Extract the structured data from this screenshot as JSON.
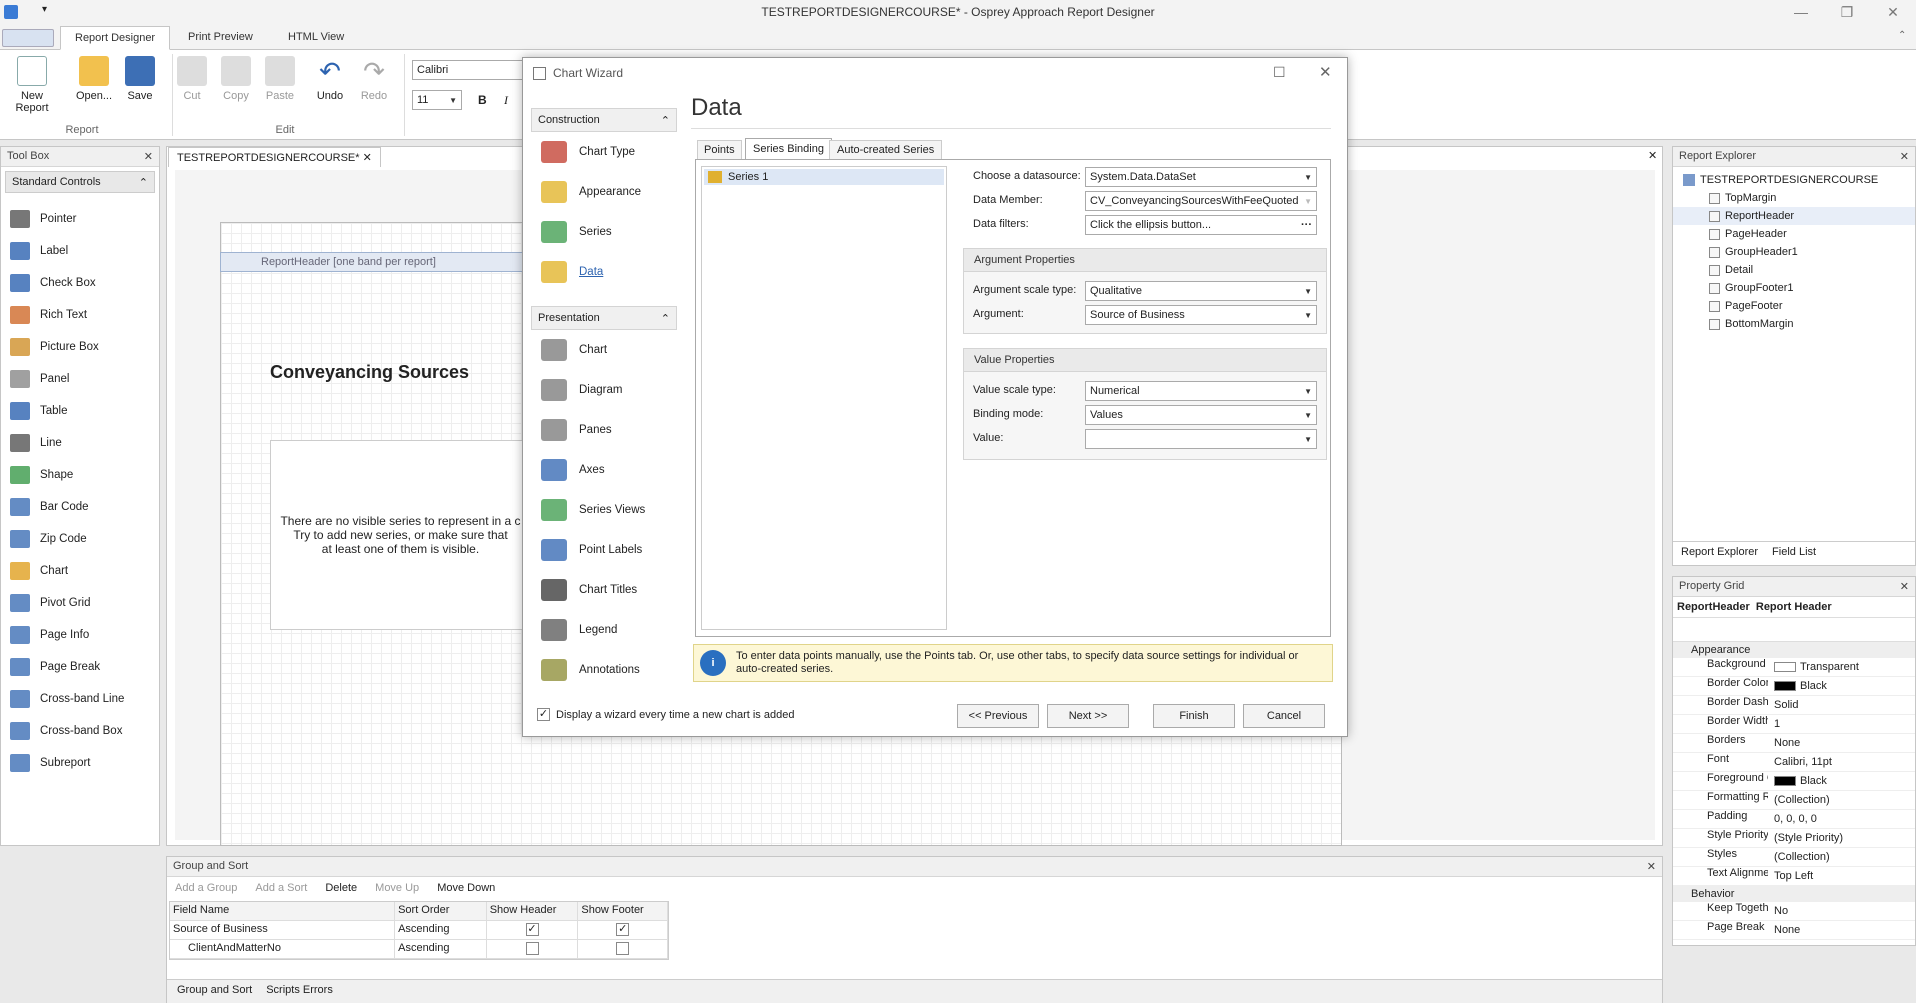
{
  "window": {
    "title": "TESTREPORTDESIGNERCOURSE* - Osprey Approach Report Designer"
  },
  "ribbon_tabs": [
    "Report Designer",
    "Print Preview",
    "HTML View"
  ],
  "ribbon": {
    "report_buttons": [
      "New Report",
      "Open...",
      "Save"
    ],
    "edit_buttons": [
      "Cut",
      "Copy",
      "Paste",
      "Undo",
      "Redo"
    ],
    "group_report": "Report",
    "group_edit": "Edit",
    "font_name": "Calibri",
    "font_size": "11",
    "bold": "B",
    "italic": "I"
  },
  "toolbox": {
    "title": "Tool Box",
    "category": "Standard Controls",
    "items": [
      "Pointer",
      "Label",
      "Check Box",
      "Rich Text",
      "Picture Box",
      "Panel",
      "Table",
      "Line",
      "Shape",
      "Bar Code",
      "Zip Code",
      "Chart",
      "Pivot Grid",
      "Page Info",
      "Page Break",
      "Cross-band Line",
      "Cross-band Box",
      "Subreport"
    ]
  },
  "document": {
    "tab": "TESTREPORTDESIGNERCOURSE*",
    "band": "ReportHeader [one band per report]",
    "heading": "Conveyancing Sources",
    "chart_msg_1": "There are no visible series to represent in a c",
    "chart_msg_2": "Try to add new series, or make sure that",
    "chart_msg_3": "at least one of them is visible."
  },
  "wizard": {
    "title": "Chart Wizard",
    "heading": "Data",
    "nav_construction": "Construction",
    "nav_construction_items": [
      "Chart Type",
      "Appearance",
      "Series",
      "Data"
    ],
    "nav_presentation": "Presentation",
    "nav_presentation_items": [
      "Chart",
      "Diagram",
      "Panes",
      "Axes",
      "Series Views",
      "Point Labels",
      "Chart Titles",
      "Legend",
      "Annotations"
    ],
    "tabs": [
      "Points",
      "Series Binding",
      "Auto-created Series"
    ],
    "series_item": "Series 1",
    "datasource_label": "Choose a datasource:",
    "datasource_value": "System.Data.DataSet",
    "member_label": "Data Member:",
    "member_value": "CV_ConveyancingSourcesWithFeeQuoted",
    "filters_label": "Data filters:",
    "filters_value": "Click the ellipsis button...",
    "arg_group": "Argument Properties",
    "arg_scale_label": "Argument scale type:",
    "arg_scale_value": "Qualitative",
    "arg_label": "Argument:",
    "arg_value": "Source of Business",
    "val_group": "Value Properties",
    "val_scale_label": "Value scale type:",
    "val_scale_value": "Numerical",
    "binding_label": "Binding mode:",
    "binding_value": "Values",
    "value_label": "Value:",
    "value_value": "",
    "info": "To enter data points manually, use the Points tab. Or, use other tabs, to specify data source settings for individual or auto-created series.",
    "show_wizard": "Display a wizard every time a new chart is added",
    "btn_prev": "<< Previous",
    "btn_next": "Next >>",
    "btn_finish": "Finish",
    "btn_cancel": "Cancel"
  },
  "report_explorer": {
    "title": "Report Explorer",
    "root": "TESTREPORTDESIGNERCOURSE",
    "items": [
      "TopMargin",
      "ReportHeader",
      "PageHeader",
      "GroupHeader1",
      "Detail",
      "GroupFooter1",
      "PageFooter",
      "BottomMargin"
    ],
    "tab_explorer": "Report Explorer",
    "tab_fields": "Field List"
  },
  "property_grid": {
    "title": "Property Grid",
    "object": "ReportHeader",
    "object_type": "Report Header",
    "cat_appearance": "Appearance",
    "rows": [
      {
        "k": "Background Col",
        "v": "Transparent"
      },
      {
        "k": "Border Color",
        "v": "Black"
      },
      {
        "k": "Border Dash Sty",
        "v": "Solid"
      },
      {
        "k": "Border Width",
        "v": "1"
      },
      {
        "k": "Borders",
        "v": "None"
      },
      {
        "k": "Font",
        "v": "Calibri, 11pt"
      },
      {
        "k": "Foreground Col",
        "v": "Black"
      },
      {
        "k": "Formatting Rule",
        "v": "(Collection)"
      },
      {
        "k": "Padding",
        "v": "0, 0, 0, 0"
      },
      {
        "k": "Style Priority",
        "v": "(Style Priority)"
      },
      {
        "k": "Styles",
        "v": "(Collection)"
      },
      {
        "k": "Text Alignment",
        "v": "Top Left"
      }
    ],
    "cat_behavior": "Behavior",
    "behavior_rows": [
      {
        "k": "Keep Together",
        "v": "No"
      },
      {
        "k": "Page Break",
        "v": "None"
      }
    ]
  },
  "group_sort": {
    "title": "Group and Sort",
    "toolbar": [
      "Add a Group",
      "Add a Sort",
      "Delete",
      "Move Up",
      "Move Down"
    ],
    "columns": [
      "Field Name",
      "Sort Order",
      "Show Header",
      "Show Footer"
    ],
    "rows": [
      {
        "field": "Source of Business",
        "order": "Ascending",
        "header": true,
        "footer": true
      },
      {
        "field": "ClientAndMatterNo",
        "order": "Ascending",
        "header": false,
        "footer": false
      }
    ],
    "tab_group": "Group and Sort",
    "tab_scripts": "Scripts Errors"
  }
}
